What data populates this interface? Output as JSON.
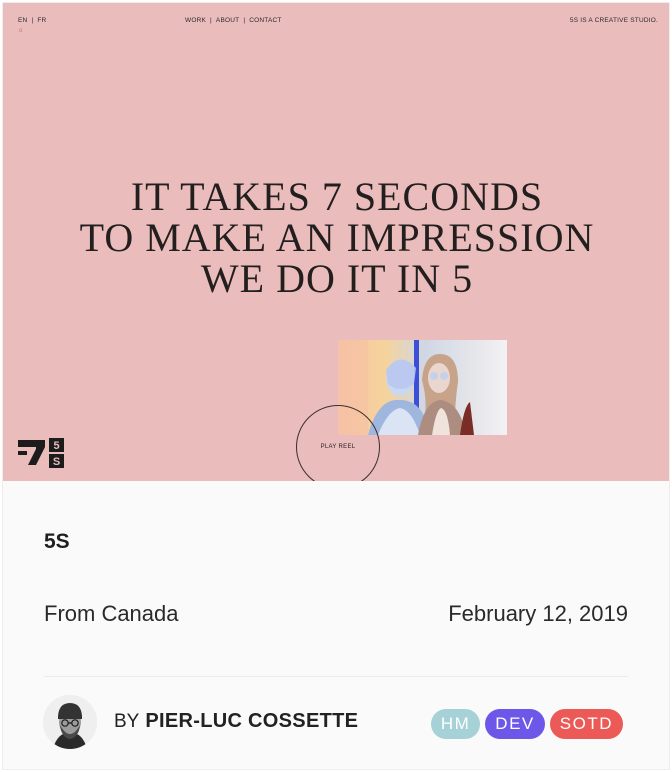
{
  "hero": {
    "background": "#ebbcbc",
    "nav": {
      "lang_en": "EN",
      "lang_fr": "FR",
      "lang_sep": "|",
      "small_mark": "o",
      "menu": [
        "WORK",
        "ABOUT",
        "CONTACT"
      ],
      "menu_sep": "|",
      "tagline": "5S IS A CREATIVE STUDIO."
    },
    "headline": [
      "IT TAKES 7 SECONDS",
      "TO MAKE AN IMPRESSION",
      "WE DO IT IN 5"
    ],
    "play_reel_label": "PLAY REEL",
    "logo_digits": [
      "5",
      "S"
    ]
  },
  "site": {
    "name": "5S",
    "country": "From Canada",
    "date": "February 12, 2019"
  },
  "author": {
    "by_label": "BY",
    "name": "PIER-LUC COSSETTE"
  },
  "badges": [
    {
      "label": "HM",
      "color": "#a6d1d6"
    },
    {
      "label": "DEV",
      "color": "#6d57e8"
    },
    {
      "label": "SOTD",
      "color": "#ec5a57"
    }
  ]
}
